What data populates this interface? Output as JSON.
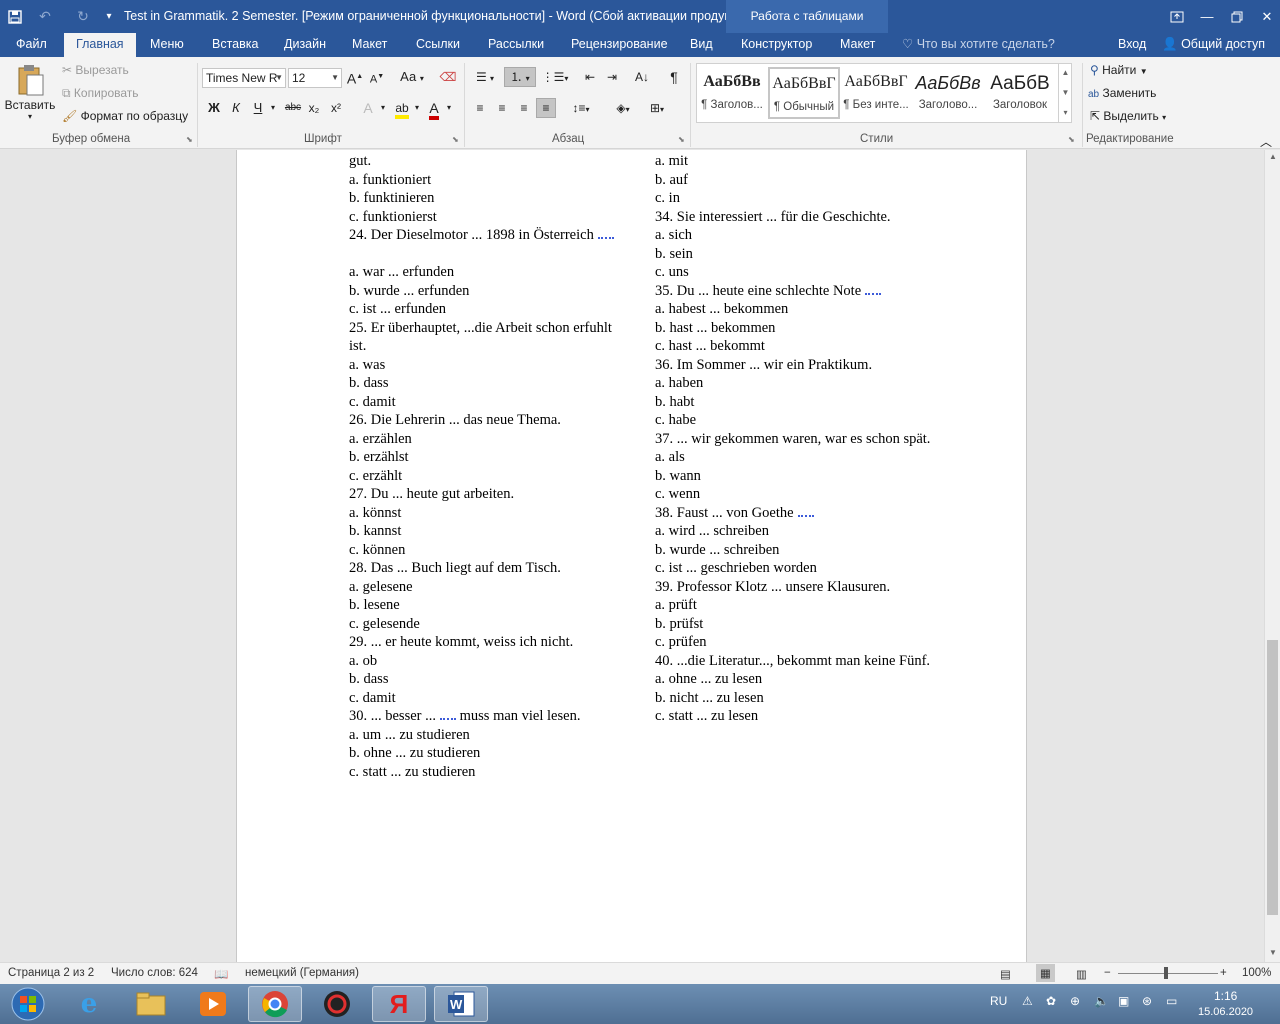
{
  "window": {
    "title": "Test in Grammatik. 2 Semester. [Режим ограниченной функциональности] - Word (Сбой активации продук...",
    "context_tab_group": "Работа с таблицами"
  },
  "tabs": {
    "file": "Файл",
    "home": "Главная",
    "menu": "Меню",
    "insert": "Вставка",
    "design": "Дизайн",
    "layout": "Макет",
    "references": "Ссылки",
    "mailings": "Рассылки",
    "review": "Рецензирование",
    "view": "Вид",
    "constructor": "Конструктор",
    "table_layout": "Макет",
    "tell_me": "Что вы хотите сделать?",
    "login": "Вход",
    "share": "Общий доступ"
  },
  "ribbon": {
    "clipboard": {
      "paste": "Вставить",
      "cut": "Вырезать",
      "copy": "Копировать",
      "format_painter": "Формат по образцу",
      "label": "Буфер обмена"
    },
    "font": {
      "name": "Times New R",
      "size": "12",
      "label": "Шрифт",
      "bold": "Ж",
      "italic": "К",
      "underline": "Ч",
      "strike": "abc",
      "subscript": "x₂",
      "superscript": "x²",
      "case": "Аа",
      "grow": "A",
      "shrink": "A"
    },
    "paragraph": {
      "label": "Абзац"
    },
    "styles": {
      "label": "Стили",
      "items": [
        {
          "sample": "АаБбВв",
          "name": "¶ Заголов..."
        },
        {
          "sample": "АаБбВвГ",
          "name": "¶ Обычный"
        },
        {
          "sample": "АаБбВвГ",
          "name": "¶ Без инте..."
        },
        {
          "sample": "АаБбВв",
          "name": "Заголово..."
        },
        {
          "sample": "АаБбВ",
          "name": "Заголовок"
        }
      ]
    },
    "editing": {
      "label": "Редактирование",
      "find": "Найти",
      "replace": "Заменить",
      "select": "Выделить"
    }
  },
  "document": {
    "left": [
      "gut.",
      "a. funktioniert",
      "b. funktinieren",
      "c. funktionierst",
      "24. Der Dieselmotor ... 1898 in Österreich",
      "",
      "a. war ... erfunden",
      "b. wurde ... erfunden",
      "c. ist ... erfunden",
      "25. Er überhauptet, ...die Arbeit schon erfuhlt",
      "ist.",
      "a. was",
      "b. dass",
      "c. damit",
      "26. Die Lehrerin ... das neue Thema.",
      "a. erzählen",
      "b. erzählst",
      "c. erzählt",
      "27. Du ... heute gut arbeiten.",
      "a. könnst",
      "b. kannst",
      "c. können",
      "28. Das ... Buch liegt auf dem Tisch.",
      "a. gelesene",
      "b. lesene",
      "c. gelesende",
      "29. ... er heute kommt, weiss ich nicht.",
      "a. ob",
      "b. dass",
      "c. damit",
      "30. ... besser ...",
      "a. um ... zu studieren",
      "b. ohne ... zu studieren",
      "c. statt ... zu studieren"
    ],
    "left30_tail": "muss man viel lesen.",
    "right": [
      "a. mit",
      "b. auf",
      "c. in",
      "34. Sie interessiert ... für die Geschichte.",
      "a. sich",
      "b. sein",
      "c. uns",
      "35. Du ... heute eine schlechte Note",
      "a. habest ... bekommen",
      "b. hast ... bekommen",
      "c. hast ... bekommt",
      "36. Im Sommer ... wir ein Praktikum.",
      "a. haben",
      "b. habt",
      "c. habe",
      "37. ... wir gekommen waren, war es schon spät.",
      "a. als",
      "b. wann",
      "c. wenn",
      "38. Faust ... von Goethe",
      "a. wird ... schreiben",
      "b. wurde ... schreiben",
      "c. ist ... geschrieben worden",
      "39. Professor Klotz ... unsere Klausuren.",
      "a. prüft",
      "b. prüfst",
      "c. prüfen",
      "40. ...die Literatur..., bekommt man keine Fünf.",
      "a. ohne ... zu lesen",
      "b. nicht ... zu lesen",
      "c. statt ... zu lesen"
    ]
  },
  "status": {
    "page": "Страница 2 из 2",
    "words": "Число слов: 624",
    "language": "немецкий (Германия)",
    "zoom": "100%"
  },
  "taskbar": {
    "lang": "RU",
    "time": "1:16",
    "date": "15.06.2020"
  }
}
